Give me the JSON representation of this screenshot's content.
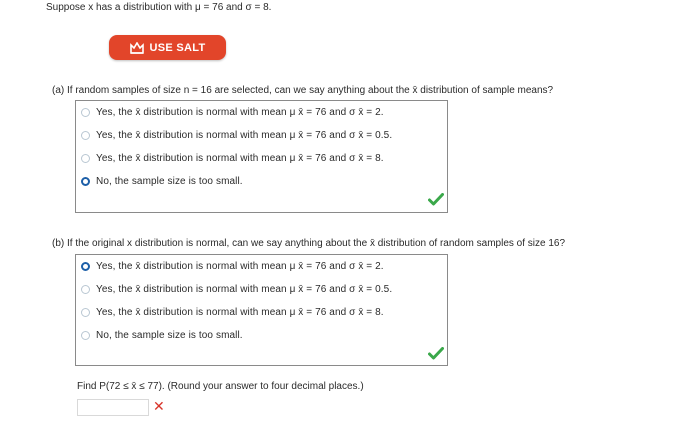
{
  "header": {
    "prompt": "Suppose x has a distribution with μ = 76 and σ = 8."
  },
  "salt_button": {
    "label": "USE SALT"
  },
  "part_a": {
    "question": "(a)   If random samples of size n = 16 are selected, can we say anything about the x̄ distribution of sample means?",
    "options": [
      "Yes, the x̄ distribution is normal with mean μ x̄ = 76 and σ x̄ = 2.",
      "Yes, the x̄ distribution is normal with mean μ x̄ = 76 and σ x̄ = 0.5.",
      "Yes, the x̄ distribution is normal with mean μ x̄ = 76 and σ x̄ = 8.",
      "No, the sample size is too small."
    ],
    "selected_index": 3,
    "status": "correct"
  },
  "part_b": {
    "question": "(b)   If the original x distribution is normal, can we say anything about the x̄ distribution of random samples of size 16?",
    "options": [
      "Yes, the x̄ distribution is normal with mean μ x̄ = 76 and σ x̄ = 2.",
      "Yes, the x̄ distribution is normal with mean μ x̄ = 76 and σ x̄ = 0.5.",
      "Yes, the x̄ distribution is normal with mean μ x̄ = 76 and σ x̄ = 8.",
      "No, the sample size is too small."
    ],
    "selected_index": 0,
    "status": "correct",
    "find_prompt": "Find P(72 ≤ x̄ ≤ 77). (Round your answer to four decimal places.)",
    "answer_value": "",
    "answer_status": "incorrect"
  },
  "colors": {
    "salt_button": "#e2452a",
    "radio_selected": "#1d5fa8",
    "check": "#3aa84a",
    "cross": "#d8342a"
  }
}
